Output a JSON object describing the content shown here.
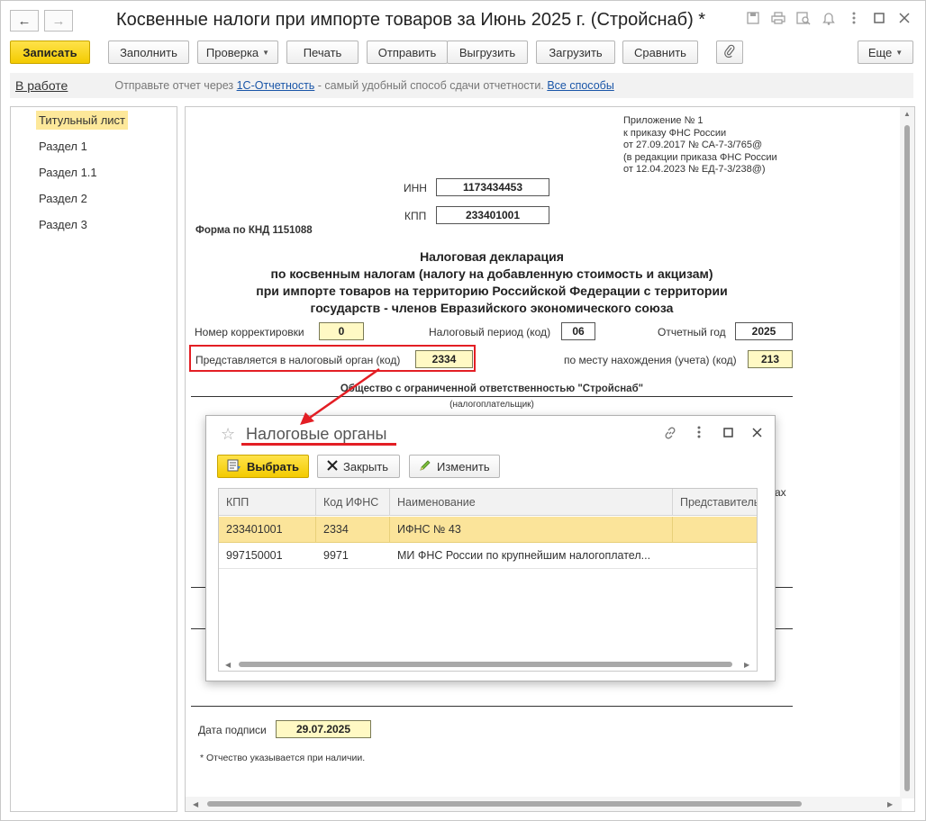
{
  "window": {
    "title": "Косвенные налоги при импорте товаров за Июнь 2025 г. (Стройснаб) *",
    "back_glyph": "←",
    "forward_glyph": "→",
    "title_icons": [
      "save-icon",
      "print-icon",
      "preview-icon",
      "bell-icon",
      "menu-icon",
      "maximize-icon",
      "close-icon"
    ]
  },
  "toolbar": {
    "save": "Записать",
    "fill": "Заполнить",
    "check": "Проверка",
    "print": "Печать",
    "send": "Отправить",
    "export": "Выгрузить",
    "import": "Загрузить",
    "compare": "Сравнить",
    "more": "Еще"
  },
  "status": {
    "label": "В работе",
    "msg_prefix": "Отправьте отчет через ",
    "msg_link1": "1С-Отчетность",
    "msg_middle": " - самый удобный способ сдачи отчетности. ",
    "msg_link2": "Все способы"
  },
  "sidebar": {
    "items": [
      {
        "label": "Титульный лист",
        "active": true
      },
      {
        "label": "Раздел 1",
        "active": false
      },
      {
        "label": "Раздел 1.1",
        "active": false
      },
      {
        "label": "Раздел 2",
        "active": false
      },
      {
        "label": "Раздел 3",
        "active": false
      }
    ]
  },
  "document": {
    "appendix": [
      "Приложение № 1",
      "к приказу ФНС России",
      "от 27.09.2017 № СА-7-3/765@",
      "(в редакции приказа ФНС России",
      "от 12.04.2023 № ЕД-7-3/238@)"
    ],
    "inn_label": "ИНН",
    "inn": "1173434453",
    "kpp_label": "КПП",
    "kpp": "233401001",
    "form_code": "Форма по КНД 1151088",
    "heading": [
      "Налоговая декларация",
      "по косвенным налогам (налогу на добавленную стоимость и акцизам)",
      "при импорте товаров на территорию Российской Федерации с территории",
      "государств - членов Евразийского экономического союза"
    ],
    "correction_label": "Номер корректировки",
    "correction": "0",
    "period_label": "Налоговый период (код)",
    "period": "06",
    "year_label": "Отчетный год",
    "year": "2025",
    "tax_office_label": "Представляется в налоговый орган (код)",
    "tax_office": "2334",
    "location_label": "по месту нахождения (учета) (код)",
    "location": "213",
    "org_name": "Общество с ограниченной ответственностью \"Стройснаб\"",
    "org_caption": "(налогоплательщик)",
    "partial_text": "ах",
    "sign_date_label": "Дата подписи",
    "sign_date": "29.07.2025",
    "footnote": "*  Отчество указывается при наличии."
  },
  "dialog": {
    "title": "Налоговые органы",
    "select": "Выбрать",
    "close": "Закрыть",
    "edit": "Изменить",
    "columns": [
      "КПП",
      "Код ИФНС",
      "Наименование",
      "Представитель"
    ],
    "rows": [
      {
        "kpp": "233401001",
        "code": "2334",
        "name": "ИФНС № 43",
        "rep": "",
        "selected": true
      },
      {
        "kpp": "997150001",
        "code": "9971",
        "name": "МИ ФНС России по крупнейшим налогоплател...",
        "rep": "",
        "selected": false
      }
    ]
  },
  "colors": {
    "accent_yellow": "#f3ca00",
    "selection": "#fbe49a",
    "annotation_red": "#e31e24",
    "link": "#1a56a8"
  }
}
